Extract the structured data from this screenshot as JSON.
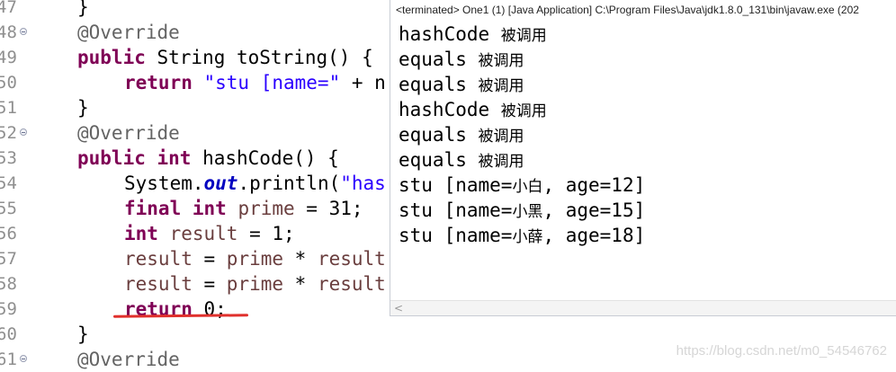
{
  "editor": {
    "lines": [
      {
        "num": "47",
        "fold": false
      },
      {
        "num": "48",
        "fold": true
      },
      {
        "num": "49",
        "fold": false
      },
      {
        "num": "50",
        "fold": false
      },
      {
        "num": "51",
        "fold": false
      },
      {
        "num": "52",
        "fold": true
      },
      {
        "num": "53",
        "fold": false
      },
      {
        "num": "54",
        "fold": false
      },
      {
        "num": "55",
        "fold": false
      },
      {
        "num": "56",
        "fold": false
      },
      {
        "num": "57",
        "fold": false
      },
      {
        "num": "58",
        "fold": false
      },
      {
        "num": "59",
        "fold": false
      },
      {
        "num": "60",
        "fold": false
      },
      {
        "num": "61",
        "fold": true
      }
    ],
    "code": {
      "l47": "}",
      "l48": "@Override",
      "l49_kw": "public",
      "l49_rest": " String toString() {",
      "l50_kw": "return",
      "l50_str": " \"stu [name=\"",
      "l50_rest": " + n",
      "l51": "}",
      "l52": "@Override",
      "l53_kw1": "public",
      "l53_kw2": " int",
      "l53_rest": " hashCode() {",
      "l54_a": "System.",
      "l54_out": "out",
      "l54_b": ".println(",
      "l54_str": "\"has",
      "l55_kw1": "final",
      "l55_kw2": " int",
      "l55_var": " prime",
      "l55_rest": " = 31;",
      "l56_kw": "int",
      "l56_var": " result",
      "l56_rest": " = 1;",
      "l57_var": "result",
      "l57_rest": " = ",
      "l57_var2": "prime",
      "l57_rest2": " * ",
      "l57_var3": "result",
      "l58_var": "result",
      "l58_rest": " = ",
      "l58_var2": "prime",
      "l58_rest2": " * ",
      "l58_var3": "result",
      "l59_kw": "return",
      "l59_rest": " 0;",
      "l60": "}",
      "l61": "@Override"
    }
  },
  "console": {
    "header": "<terminated> One1 (1) [Java Application] C:\\Program Files\\Java\\jdk1.8.0_131\\bin\\javaw.exe (202",
    "output": [
      {
        "code": "hashCode ",
        "cjk": "被调用",
        "tail": ""
      },
      {
        "code": "equals ",
        "cjk": "被调用",
        "tail": ""
      },
      {
        "code": "equals ",
        "cjk": "被调用",
        "tail": ""
      },
      {
        "code": "hashCode ",
        "cjk": "被调用",
        "tail": ""
      },
      {
        "code": "equals ",
        "cjk": "被调用",
        "tail": ""
      },
      {
        "code": "equals ",
        "cjk": "被调用",
        "tail": ""
      },
      {
        "code": "stu [name=",
        "cjk": "小白",
        "tail": ", age=12]"
      },
      {
        "code": "stu [name=",
        "cjk": "小黑",
        "tail": ", age=15]"
      },
      {
        "code": "stu [name=",
        "cjk": "小薛",
        "tail": ", age=18]"
      }
    ],
    "scroll_left_glyph": "<"
  },
  "watermark": "https://blog.csdn.net/m0_54546762",
  "colors": {
    "keyword": "#7f0055",
    "annotation": "#646464",
    "string": "#2a00ff",
    "static_field": "#0000c0",
    "local_var": "#6a3e3e",
    "red_mark": "#e0302c"
  }
}
